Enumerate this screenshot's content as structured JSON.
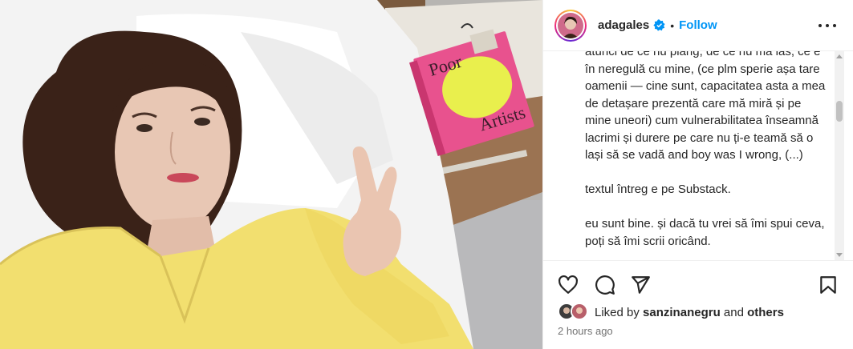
{
  "post": {
    "username": "adagales",
    "separator": "•",
    "follow_label": "Follow",
    "verified_icon": "verified-badge-icon",
    "more_icon": "more-options-icon"
  },
  "photo": {
    "book_title_line1": "Poor",
    "book_title_line2": "Artists",
    "book_spine_text": "Poor Artists"
  },
  "caption": {
    "paragraph1": "atunci de ce nu plâng, de ce nu mă las, ce e în neregulă cu mine, (ce plm sperie așa tare oamenii — cine sunt, capacitatea asta a mea de detașare prezentă care mă miră și pe mine uneori) cum vulnerabilitatea înseamnă lacrimi și durere pe care nu ți-e teamă să o lași să se vadă and boy was I wrong, (...)",
    "paragraph2": "textul întreg e pe Substack.",
    "paragraph3": "eu sunt bine. și dacă tu vrei să îmi spui ceva, poți să îmi scrii oricând."
  },
  "actions": {
    "like_icon": "heart-icon",
    "comment_icon": "comment-icon",
    "share_icon": "share-icon",
    "save_icon": "bookmark-icon"
  },
  "likes": {
    "prefix": "Liked by",
    "user": "sanzinanegru",
    "connector": "and",
    "others": "others"
  },
  "timestamp": "2 hours ago",
  "colors": {
    "accent": "#0095f6",
    "text": "#262626",
    "muted": "#737373",
    "pajama": "#f2df6f",
    "book": "#e8528e"
  }
}
